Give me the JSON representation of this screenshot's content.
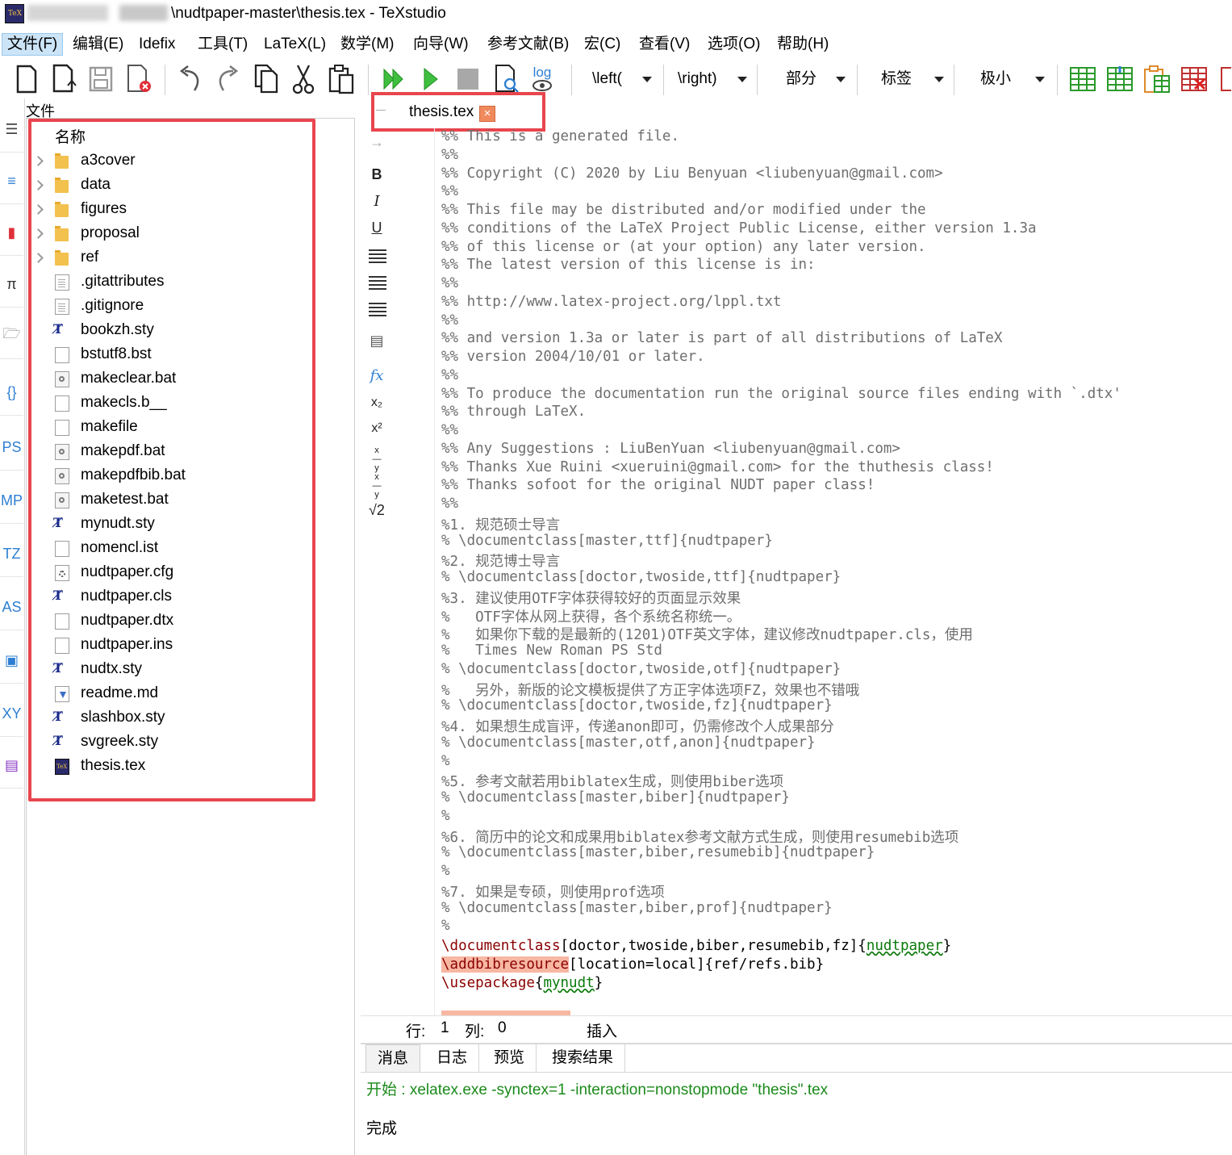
{
  "window": {
    "title": "\\nudtpaper-master\\thesis.tex - TeXstudio"
  },
  "menu": [
    "文件(F)",
    "编辑(E)",
    "Idefix",
    "工具(T)",
    "LaTeX(L)",
    "数学(M)",
    "向导(W)",
    "参考文献(B)",
    "宏(C)",
    "查看(V)",
    "选项(O)",
    "帮助(H)"
  ],
  "toolbar": {
    "combos": [
      "\\left(",
      "\\right)",
      "部分",
      "标签",
      "极小"
    ],
    "log_label": "log"
  },
  "left_sidebar": {
    "labels": [
      "PS",
      "MP",
      "TZ",
      "AS",
      "XY"
    ]
  },
  "file_panel": {
    "title": "文件",
    "header": "名称",
    "items": [
      {
        "name": "a3cover",
        "type": "folder"
      },
      {
        "name": "data",
        "type": "folder"
      },
      {
        "name": "figures",
        "type": "folder"
      },
      {
        "name": "proposal",
        "type": "folder"
      },
      {
        "name": "ref",
        "type": "folder"
      },
      {
        "name": ".gitattributes",
        "type": "text"
      },
      {
        "name": ".gitignore",
        "type": "text"
      },
      {
        "name": "bookzh.sty",
        "type": "sty"
      },
      {
        "name": "bstutf8.bst",
        "type": "blank"
      },
      {
        "name": "makeclear.bat",
        "type": "bat"
      },
      {
        "name": "makecls.b__",
        "type": "blank"
      },
      {
        "name": "makefile",
        "type": "blank"
      },
      {
        "name": "makepdf.bat",
        "type": "bat"
      },
      {
        "name": "makepdfbib.bat",
        "type": "bat"
      },
      {
        "name": "maketest.bat",
        "type": "bat"
      },
      {
        "name": "mynudt.sty",
        "type": "sty"
      },
      {
        "name": "nomencl.ist",
        "type": "blank"
      },
      {
        "name": "nudtpaper.cfg",
        "type": "cfg"
      },
      {
        "name": "nudtpaper.cls",
        "type": "sty"
      },
      {
        "name": "nudtpaper.dtx",
        "type": "blank"
      },
      {
        "name": "nudtpaper.ins",
        "type": "blank"
      },
      {
        "name": "nudtx.sty",
        "type": "sty"
      },
      {
        "name": "readme.md",
        "type": "md"
      },
      {
        "name": "slashbox.sty",
        "type": "sty"
      },
      {
        "name": "svgreek.sty",
        "type": "sty"
      },
      {
        "name": "thesis.tex",
        "type": "tex"
      }
    ]
  },
  "editor": {
    "tab": "thesis.tex",
    "tab_close": "×",
    "format_buttons": [
      "B",
      "I",
      "U",
      "fx",
      "x₂",
      "x²",
      "√2"
    ],
    "lines": [
      "%% This is a generated file.",
      "%%",
      "%% Copyright (C) 2020 by Liu Benyuan <liubenyuan@gmail.com>",
      "%%",
      "%% This file may be distributed and/or modified under the",
      "%% conditions of the LaTeX Project Public License, either version 1.3a",
      "%% of this license or (at your option) any later version.",
      "%% The latest version of this license is in:",
      "%%",
      "%% http://www.latex-project.org/lppl.txt",
      "%%",
      "%% and version 1.3a or later is part of all distributions of LaTeX",
      "%% version 2004/10/01 or later.",
      "%%",
      "%% To produce the documentation run the original source files ending with `.dtx'",
      "%% through LaTeX.",
      "%%",
      "%% Any Suggestions : LiuBenYuan <liubenyuan@gmail.com>",
      "%% Thanks Xue Ruini <xueruini@gmail.com> for the thuthesis class!",
      "%% Thanks sofoot for the original NUDT paper class!",
      "%%",
      "%1. 规范硕士导言",
      "% \\documentclass[master,ttf]{nudtpaper}",
      "%2. 规范博士导言",
      "% \\documentclass[doctor,twoside,ttf]{nudtpaper}",
      "%3. 建议使用OTF字体获得较好的页面显示效果",
      "%   OTF字体从网上获得，各个系统名称统一。",
      "%   如果你下载的是最新的(1201)OTF英文字体，建议修改nudtpaper.cls，使用",
      "%   Times New Roman PS Std",
      "% \\documentclass[doctor,twoside,otf]{nudtpaper}",
      "%   另外，新版的论文模板提供了方正字体选项FZ，效果也不错哦",
      "% \\documentclass[doctor,twoside,fz]{nudtpaper}",
      "%4. 如果想生成盲评，传递anon即可，仍需修改个人成果部分",
      "% \\documentclass[master,otf,anon]{nudtpaper}",
      "%",
      "%5. 参考文献若用biblatex生成，则使用biber选项",
      "% \\documentclass[master,biber]{nudtpaper}",
      "%",
      "%6. 简历中的论文和成果用biblatex参考文献方式生成，则使用resumebib选项",
      "% \\documentclass[master,biber,resumebib]{nudtpaper}",
      "%",
      "%7. 如果是专硕，则使用prof选项",
      "% \\documentclass[master,biber,prof]{nudtpaper}",
      "%"
    ],
    "code": {
      "l1_cmd": "\\documentclass",
      "l1_opt": "[doctor,twoside,biber,resumebib,fz]{",
      "l1_arg": "nudtpaper",
      "l1_end": "}",
      "l2_cmd": "\\addbibresource",
      "l2_rest": "[location=local]{ref/refs.bib}",
      "l3_cmd": "\\usepackage",
      "l3_open": "{",
      "l3_arg": "mynudt",
      "l3_end": "}"
    }
  },
  "status": {
    "row_label": "行:",
    "row": "1",
    "col_label": "列:",
    "col": "0",
    "mode": "插入"
  },
  "bottom_panel": {
    "tabs": [
      "消息",
      "日志",
      "预览",
      "搜索结果"
    ],
    "message_start": "开始 : xelatex.exe -synctex=1 -interaction=nonstopmode \"thesis\".tex",
    "message_done": "完成"
  }
}
